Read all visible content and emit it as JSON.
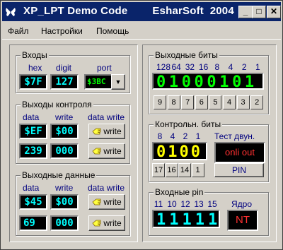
{
  "window": {
    "title": "XP_LPT Demo Code        EsharSoft  2004"
  },
  "titlebar": {
    "min": "_",
    "max": "□",
    "close": "✕"
  },
  "menu": [
    "Файл",
    "Настройки",
    "Помощь"
  ],
  "inputs": {
    "title": "Входы",
    "hex_label": "hex",
    "digit_label": "digit",
    "port_label": "port",
    "hex_value": "$7F",
    "digit_value": "127",
    "port_value": "$3BC",
    "dropdown_arrow": "▼"
  },
  "control_outputs": {
    "title": "Выходы контроля",
    "col_data": "data",
    "col_write": "write",
    "col_data_write": "data write",
    "row1": {
      "data": "$EF",
      "write": "$00",
      "btn": "write"
    },
    "row2": {
      "data": "239",
      "write": "000",
      "btn": "write"
    }
  },
  "data_outputs": {
    "title": "Выходные данные",
    "col_data": "data",
    "col_write": "write",
    "col_data_write": "data write",
    "row1": {
      "data": "$45",
      "write": "$00",
      "btn": "write"
    },
    "row2": {
      "data": "69",
      "write": "000",
      "btn": "write"
    }
  },
  "output_bits": {
    "title": "Выходные биты",
    "weights": [
      "128",
      "64",
      "32",
      "16",
      "8",
      "4",
      "2",
      "1"
    ],
    "bits": "01000101",
    "buttons": [
      "9",
      "8",
      "7",
      "6",
      "5",
      "4",
      "3",
      "2"
    ]
  },
  "control_bits": {
    "title": "Контрольн. биты",
    "weights": [
      "8",
      "4",
      "2",
      "1"
    ],
    "test_label": "Тест двун.",
    "bits": "0100",
    "status": "onli out",
    "buttons": [
      "17",
      "16",
      "14",
      "1"
    ],
    "pin_button": "PIN"
  },
  "input_pins": {
    "title": "Входные pin",
    "labels": [
      "11",
      "10",
      "12",
      "13",
      "15"
    ],
    "core_label": "Ядро",
    "bits": "11111",
    "core_value": "NT"
  },
  "colors": {
    "titlebar": "#0a246a",
    "lcd_cyan": "#00ffff",
    "lcd_green": "#00ff00",
    "lcd_yellow": "#ffff00",
    "lcd_red": "#ff3030"
  }
}
